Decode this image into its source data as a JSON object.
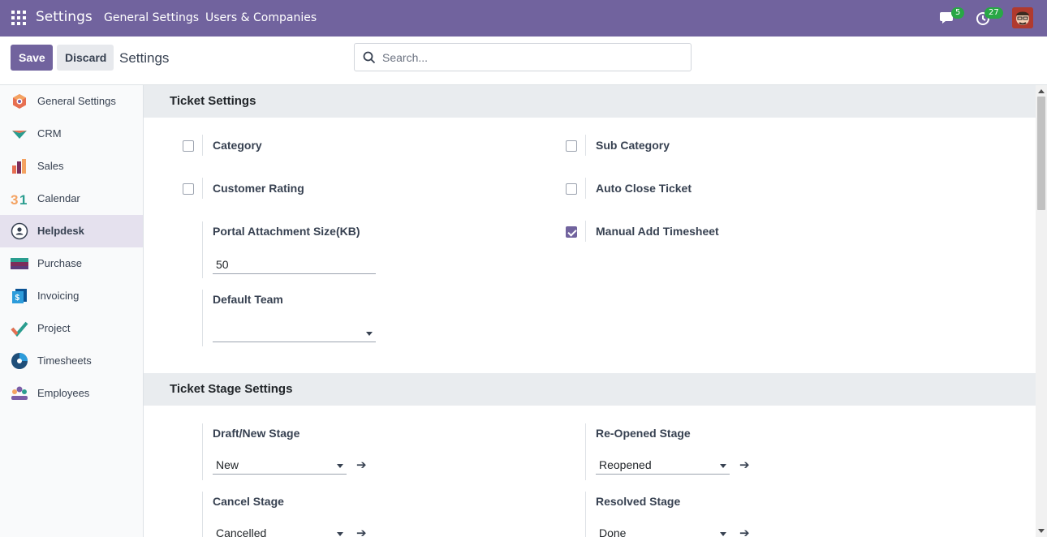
{
  "navbar": {
    "app_title": "Settings",
    "menu": [
      "General Settings",
      "Users & Companies"
    ],
    "messages_count": "5",
    "activities_count": "27",
    "brand_color": "#71639e"
  },
  "control_panel": {
    "save_label": "Save",
    "discard_label": "Discard",
    "title": "Settings",
    "search_placeholder": "Search..."
  },
  "sidebar": {
    "items": [
      {
        "label": "General Settings",
        "icon": "general-settings-icon"
      },
      {
        "label": "CRM",
        "icon": "crm-icon"
      },
      {
        "label": "Sales",
        "icon": "sales-icon"
      },
      {
        "label": "Calendar",
        "icon": "calendar-icon"
      },
      {
        "label": "Helpdesk",
        "icon": "helpdesk-icon",
        "active": true
      },
      {
        "label": "Purchase",
        "icon": "purchase-icon"
      },
      {
        "label": "Invoicing",
        "icon": "invoicing-icon"
      },
      {
        "label": "Project",
        "icon": "project-icon"
      },
      {
        "label": "Timesheets",
        "icon": "timesheets-icon"
      },
      {
        "label": "Employees",
        "icon": "employees-icon"
      }
    ]
  },
  "ticket_settings": {
    "title": "Ticket Settings",
    "category": {
      "label": "Category",
      "checked": false
    },
    "sub_category": {
      "label": "Sub Category",
      "checked": false
    },
    "customer_rating": {
      "label": "Customer Rating",
      "checked": false
    },
    "auto_close_ticket": {
      "label": "Auto Close Ticket",
      "checked": false
    },
    "portal_attachment": {
      "label": "Portal Attachment Size(KB)",
      "value": "50"
    },
    "manual_add_timesheet": {
      "label": "Manual Add Timesheet",
      "checked": true
    },
    "default_team": {
      "label": "Default Team",
      "value": ""
    }
  },
  "ticket_stage_settings": {
    "title": "Ticket Stage Settings",
    "draft_new_stage": {
      "label": "Draft/New Stage",
      "value": "New"
    },
    "reopened_stage": {
      "label": "Re-Opened Stage",
      "value": "Reopened"
    },
    "cancel_stage": {
      "label": "Cancel Stage",
      "value": "Cancelled"
    },
    "resolved_stage": {
      "label": "Resolved Stage",
      "value": "Done"
    }
  }
}
